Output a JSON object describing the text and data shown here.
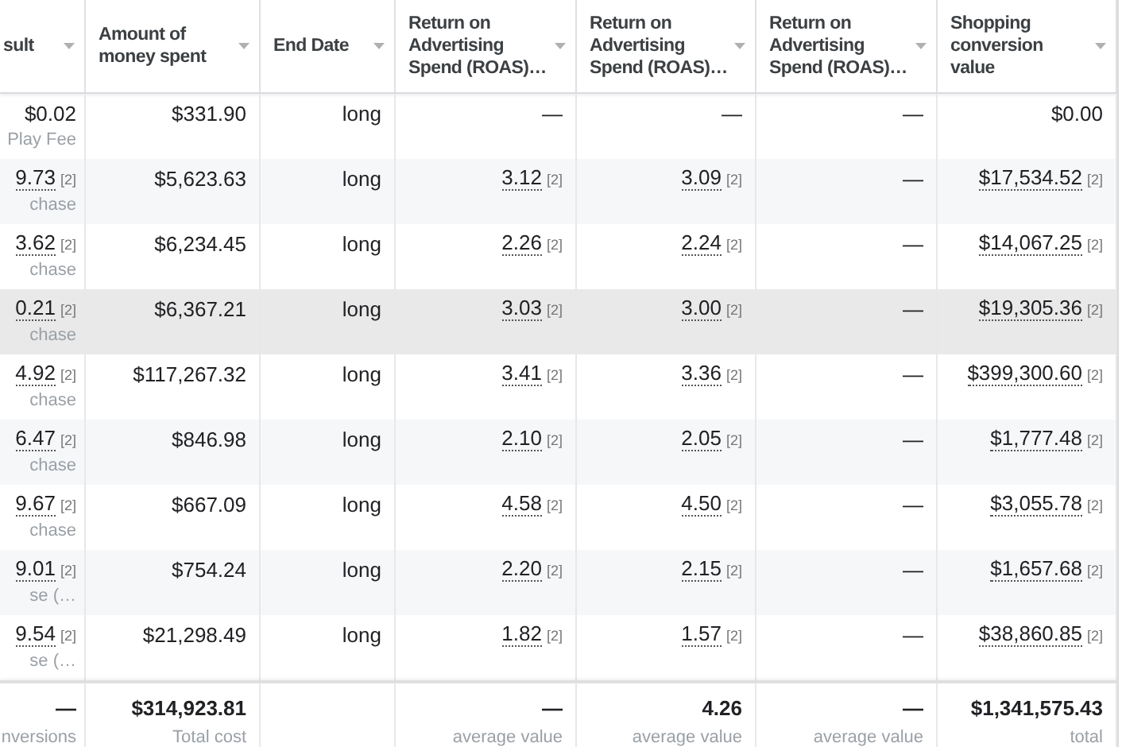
{
  "columns": [
    {
      "label": "sult"
    },
    {
      "label": "Amount of money spent"
    },
    {
      "label": "End Date"
    },
    {
      "label": "Return on Advertising Spend (ROAS)…"
    },
    {
      "label": "Return on Advertising Spend (ROAS)…"
    },
    {
      "label": "Return on Advertising Spend (ROAS)…"
    },
    {
      "label": "Shopping conversion value"
    }
  ],
  "rows": [
    {
      "hovered": false,
      "cells": [
        {
          "value": "$0.02",
          "sub": "Play Fee"
        },
        {
          "value": "$331.90"
        },
        {
          "value": "long"
        },
        {
          "value": "—"
        },
        {
          "value": "—"
        },
        {
          "value": "—"
        },
        {
          "value": "$0.00"
        }
      ]
    },
    {
      "hovered": false,
      "cells": [
        {
          "value": "9.73",
          "note": "[2]",
          "sub": "chase"
        },
        {
          "value": "$5,623.63"
        },
        {
          "value": "long"
        },
        {
          "value": "3.12",
          "note": "[2]"
        },
        {
          "value": "3.09",
          "note": "[2]"
        },
        {
          "value": "—"
        },
        {
          "value": "$17,534.52",
          "note": "[2]"
        }
      ]
    },
    {
      "hovered": false,
      "cells": [
        {
          "value": "3.62",
          "note": "[2]",
          "sub": "chase"
        },
        {
          "value": "$6,234.45"
        },
        {
          "value": "long"
        },
        {
          "value": "2.26",
          "note": "[2]"
        },
        {
          "value": "2.24",
          "note": "[2]"
        },
        {
          "value": "—"
        },
        {
          "value": "$14,067.25",
          "note": "[2]"
        }
      ]
    },
    {
      "hovered": true,
      "cells": [
        {
          "value": "0.21",
          "note": "[2]",
          "sub": "chase"
        },
        {
          "value": "$6,367.21"
        },
        {
          "value": "long"
        },
        {
          "value": "3.03",
          "note": "[2]"
        },
        {
          "value": "3.00",
          "note": "[2]"
        },
        {
          "value": "—"
        },
        {
          "value": "$19,305.36",
          "note": "[2]"
        }
      ]
    },
    {
      "hovered": false,
      "cells": [
        {
          "value": "4.92",
          "note": "[2]",
          "sub": "chase"
        },
        {
          "value": "$117,267.32"
        },
        {
          "value": "long"
        },
        {
          "value": "3.41",
          "note": "[2]"
        },
        {
          "value": "3.36",
          "note": "[2]"
        },
        {
          "value": "—"
        },
        {
          "value": "$399,300.60",
          "note": "[2]"
        }
      ]
    },
    {
      "hovered": false,
      "cells": [
        {
          "value": "6.47",
          "note": "[2]",
          "sub": "chase"
        },
        {
          "value": "$846.98"
        },
        {
          "value": "long"
        },
        {
          "value": "2.10",
          "note": "[2]"
        },
        {
          "value": "2.05",
          "note": "[2]"
        },
        {
          "value": "—"
        },
        {
          "value": "$1,777.48",
          "note": "[2]"
        }
      ]
    },
    {
      "hovered": false,
      "cells": [
        {
          "value": "9.67",
          "note": "[2]",
          "sub": "chase"
        },
        {
          "value": "$667.09"
        },
        {
          "value": "long"
        },
        {
          "value": "4.58",
          "note": "[2]"
        },
        {
          "value": "4.50",
          "note": "[2]"
        },
        {
          "value": "—"
        },
        {
          "value": "$3,055.78",
          "note": "[2]"
        }
      ]
    },
    {
      "hovered": false,
      "cells": [
        {
          "value": "9.01",
          "note": "[2]",
          "sub": "se (…"
        },
        {
          "value": "$754.24"
        },
        {
          "value": "long"
        },
        {
          "value": "2.20",
          "note": "[2]"
        },
        {
          "value": "2.15",
          "note": "[2]"
        },
        {
          "value": "—"
        },
        {
          "value": "$1,657.68",
          "note": "[2]"
        }
      ]
    },
    {
      "hovered": false,
      "cells": [
        {
          "value": "9.54",
          "note": "[2]",
          "sub": "se (…"
        },
        {
          "value": "$21,298.49"
        },
        {
          "value": "long"
        },
        {
          "value": "1.82",
          "note": "[2]"
        },
        {
          "value": "1.57",
          "note": "[2]"
        },
        {
          "value": "—"
        },
        {
          "value": "$38,860.85",
          "note": "[2]"
        }
      ]
    }
  ],
  "totals": {
    "result": {
      "value": "—",
      "sub": "nversions"
    },
    "money_spent": {
      "value": "$314,923.81",
      "sub": "Total cost"
    },
    "roas_1": {
      "value": "—",
      "sub": "average value"
    },
    "roas_2": {
      "value": "4.26",
      "sub": "average value"
    },
    "roas_3": {
      "value": "—",
      "sub": "average value"
    },
    "shopping_conversion_value": {
      "value": "$1,341,575.43",
      "sub": "total"
    }
  }
}
